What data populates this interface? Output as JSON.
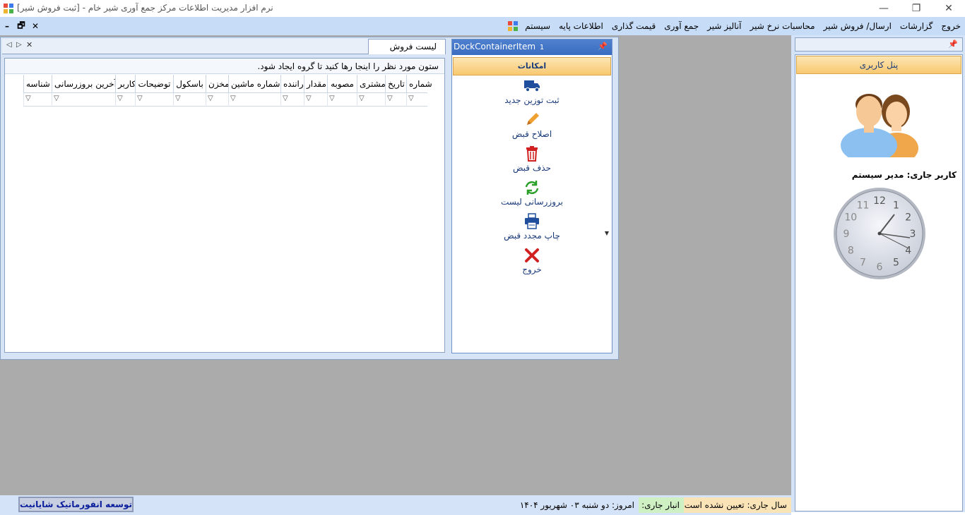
{
  "window": {
    "title": "نرم افزار مدیریت اطلاعات مرکز جمع آوری شیر خام - [ثبت فروش شیر]",
    "minimize_glyph": "—",
    "restore_glyph": "❐",
    "close_glyph": "✕"
  },
  "menu": {
    "items": [
      "سیستم",
      "اطلاعات پایه",
      "قیمت گذاری",
      "جمع آوری",
      "آنالیز شیر",
      "محاسبات نرخ شیر",
      "ارسال/ فروش شیر",
      "گزارشات",
      "خروج"
    ],
    "mdi_minimize": "–",
    "mdi_restore": "🗗",
    "mdi_close": "✕"
  },
  "document": {
    "tab_label": "لیست فروش",
    "tab_prev": "◁",
    "tab_next": "▷",
    "tab_close": "✕",
    "group_panel_text": "ستون مورد نظر را اینجا رها کنید تا گروه ایجاد شود.",
    "columns": [
      "شماره",
      "تاریخ",
      "مشتری",
      "مصوبه",
      "مقدار",
      "راننده",
      "شماره ماشین",
      "مخزن",
      "باسکول",
      "توضیحات",
      "کاربر",
      "آخرین بروزرسانی",
      "شناسه"
    ],
    "filter_glyph": "▽"
  },
  "dock": {
    "title": "DockContainerItem",
    "title_suffix": "1",
    "pin_glyph": "📌",
    "group_title": "امکانات",
    "scroll_glyph": "▼",
    "actions": [
      {
        "label": "ثبت توزین جدید",
        "icon": "truck-icon",
        "color": "#1f4f9c"
      },
      {
        "label": "اصلاح قبض",
        "icon": "pencil-icon",
        "color": "#f0a030"
      },
      {
        "label": "حذف قبض",
        "icon": "trash-icon",
        "color": "#d02020"
      },
      {
        "label": "بروزرسانی لیست",
        "icon": "refresh-icon",
        "color": "#2aa02a"
      },
      {
        "label": "چاپ مجدد قبض",
        "icon": "printer-icon",
        "color": "#1f4f9c"
      },
      {
        "label": "خروج",
        "icon": "close-icon",
        "color": "#d02020"
      }
    ]
  },
  "user_panel": {
    "title": "پنل کاربری",
    "pin_glyph": "📌",
    "current_user_label": "کاربر جاری: مدیر سیستم",
    "clock_numbers": [
      "12",
      "1",
      "2",
      "3",
      "4",
      "5",
      "6",
      "7",
      "8",
      "9",
      "10",
      "11"
    ]
  },
  "status": {
    "fiscal_year": "سال جاری: تعیین نشده است",
    "warehouse": "انبار جاری:",
    "today": "امروز: دو شنبه ۰۳ شهریور ۱۴۰۴",
    "brand": "توسعه انفورماتیک شایانیت",
    "fiscal_color": "#fbe3b8",
    "warehouse_color": "#cff0c2"
  }
}
